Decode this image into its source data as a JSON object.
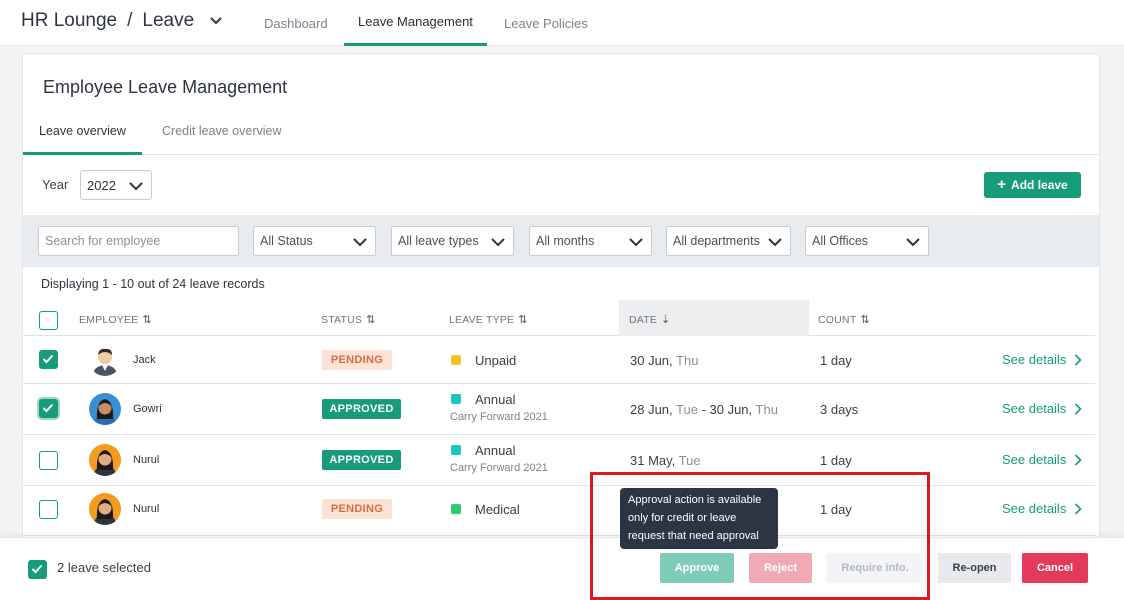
{
  "nav": {
    "app_name": "HR Lounge",
    "separator": "/",
    "module": "Leave",
    "tabs": [
      {
        "label": "Dashboard",
        "active": false
      },
      {
        "label": "Leave Management",
        "active": true
      },
      {
        "label": "Leave Policies",
        "active": false
      }
    ]
  },
  "page": {
    "title": "Employee Leave Management",
    "subtabs": [
      {
        "label": "Leave overview",
        "active": true
      },
      {
        "label": "Credit leave overview",
        "active": false
      }
    ],
    "year_label": "Year",
    "year_value": "2022",
    "add_button": "Add leave"
  },
  "filters": {
    "search_placeholder": "Search for employee",
    "status": "All Status",
    "leave_types": "All leave types",
    "months": "All months",
    "departments": "All departments",
    "offices": "All Offices"
  },
  "table": {
    "display_text": "Displaying 1 - 10 out of 24 leave records",
    "columns": [
      "EMPLOYEE",
      "STATUS",
      "LEAVE TYPE",
      "DATE",
      "COUNT"
    ],
    "rows": [
      {
        "name": "Jack",
        "status": "PENDING",
        "status_type": "pending",
        "leave_type": "Unpaid",
        "leave_color": "#f5c51d",
        "leave_sub": "",
        "date_a": "30 Jun, ",
        "date_b": "Thu",
        "date_c": "",
        "date_d": "",
        "count": "1 day",
        "details": "See details",
        "checked": true
      },
      {
        "name": "Gowri",
        "status": "APPROVED",
        "status_type": "approved",
        "leave_type": "Annual",
        "leave_color": "#1ec6c0",
        "leave_sub": "Carry Forward 2021",
        "date_a": "28 Jun, ",
        "date_b": "Tue",
        "date_c": " - 30 Jun, ",
        "date_d": "Thu",
        "count": "3 days",
        "details": "See details",
        "checked": true
      },
      {
        "name": "Nurul",
        "status": "APPROVED",
        "status_type": "approved",
        "leave_type": "Annual",
        "leave_color": "#1ec6c0",
        "leave_sub": "Carry Forward 2021",
        "date_a": "31 May, ",
        "date_b": "Tue",
        "date_c": "",
        "date_d": "",
        "count": "1 day",
        "details": "See details",
        "checked": false
      },
      {
        "name": "Nurul",
        "status": "PENDING",
        "status_type": "pending",
        "leave_type": "Medical",
        "leave_color": "#2ecc71",
        "leave_sub": "",
        "date_a": "",
        "date_b": "",
        "date_c": "",
        "date_d": "",
        "count": "1 day",
        "details": "See details",
        "checked": false
      }
    ]
  },
  "action_bar": {
    "selected_text": "2 leave selected",
    "approve": "Approve",
    "reject": "Reject",
    "require_info": "Require info.",
    "reopen": "Re-open",
    "cancel": "Cancel"
  },
  "tooltip": {
    "text": "Approval action is available only for credit or leave request that need approval"
  },
  "colors": {
    "accent": "#169b7b",
    "cancel": "#e3395a",
    "highlight": "#e0171d"
  }
}
